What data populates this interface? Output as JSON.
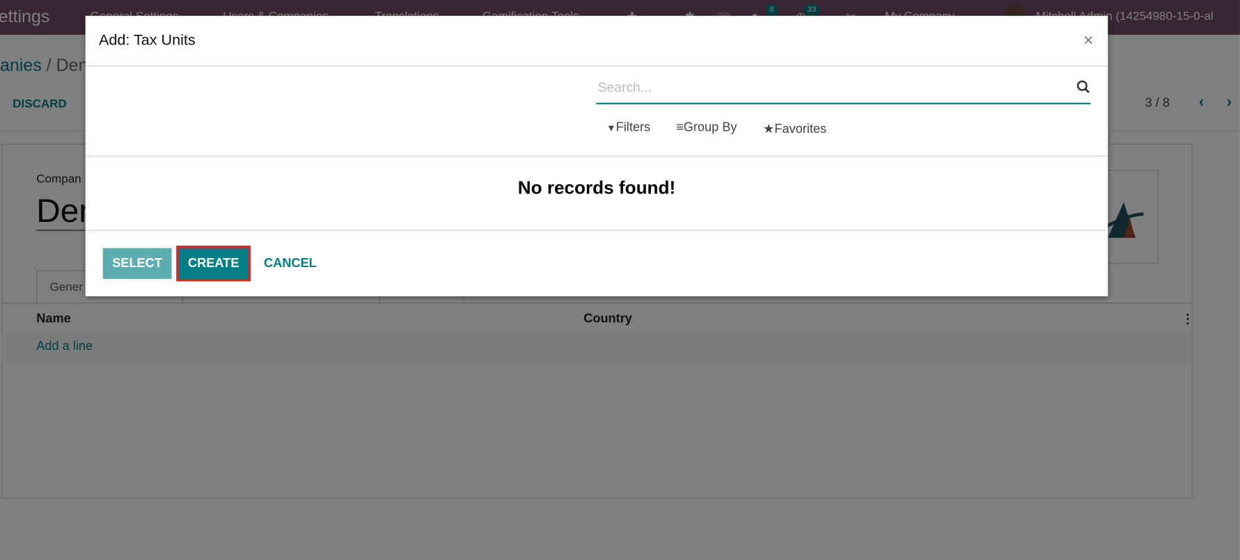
{
  "navbar": {
    "app_title": "ettings",
    "menus": [
      "General Settings",
      "Users & Companies",
      "Translations",
      "Gamification Tools"
    ],
    "messages_count": "8",
    "activities_count": "33",
    "company": "My Company",
    "user": "Mitchell Admin (14254980-15-0-al",
    "color": "#714b67"
  },
  "breadcrumb": {
    "parent": "anies",
    "separator": " / ",
    "current": "Den"
  },
  "toolbar": {
    "discard": "DISCARD",
    "pager": "3 / 8"
  },
  "form": {
    "company_label": "Compan",
    "company_name": "Den",
    "tab_first": "Gener",
    "columns": [
      "Name",
      "Country"
    ],
    "add_line": "Add a line"
  },
  "dialog": {
    "title": "Add: Tax Units",
    "close": "×",
    "search_placeholder": "Search...",
    "filters": "Filters",
    "group_by": "Group By",
    "favorites": "Favorites",
    "empty": "No records found!",
    "select": "SELECT",
    "create": "CREATE",
    "cancel": "CANCEL"
  },
  "colors": {
    "accent": "#017e84",
    "select_bg": "#5fadb1",
    "highlight": "#e8202a"
  }
}
